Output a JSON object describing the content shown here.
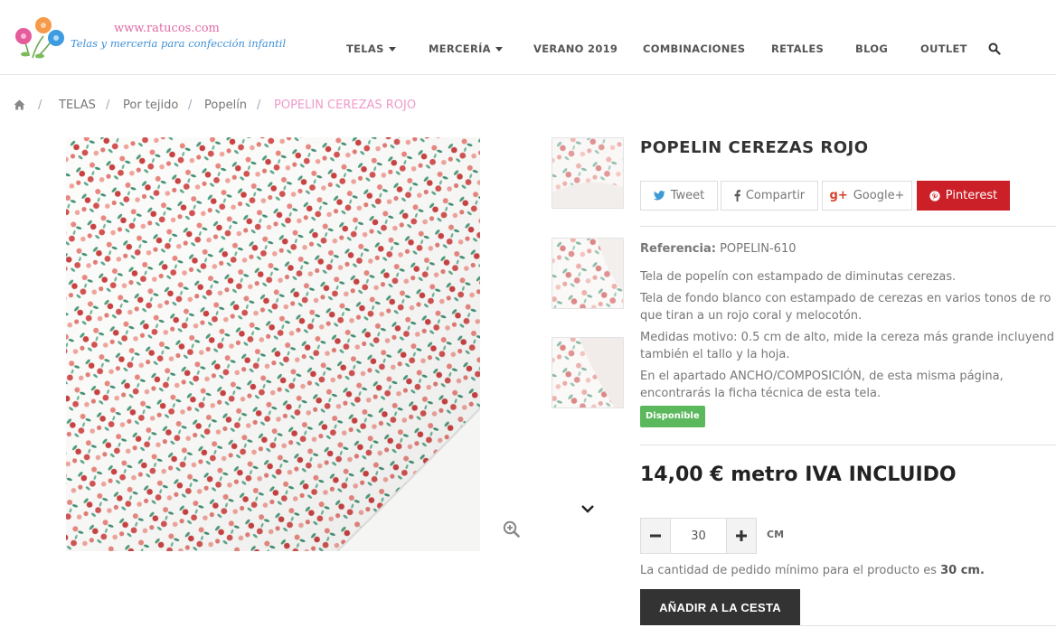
{
  "site": {
    "url_text": "www.ratucos.com",
    "tagline": "Telas y merceria para confección infantil"
  },
  "nav": [
    {
      "label": "TELAS",
      "has_caret": true
    },
    {
      "label": "MERCERÍA",
      "has_caret": true
    },
    {
      "label": "VERANO 2019",
      "has_caret": false
    },
    {
      "label": "COMBINACIONES",
      "has_caret": false
    },
    {
      "label": "RETALES",
      "has_caret": false
    },
    {
      "label": "BLOG",
      "has_caret": false
    },
    {
      "label": "OUTLET",
      "has_caret": false
    }
  ],
  "breadcrumb": {
    "separator": "/",
    "items": [
      "TELAS",
      "Por tejido",
      "Popelín"
    ],
    "current": "POPELIN CEREZAS ROJO"
  },
  "product": {
    "title": "POPELIN CEREZAS ROJO",
    "share": {
      "tweet": "Tweet",
      "facebook": "Compartir",
      "google": "Google+",
      "pinterest": "Pinterest"
    },
    "reference_label": "Referencia:",
    "reference_value": "POPELIN-610",
    "description": [
      "Tela de popelín con estampado de diminutas cerezas.",
      "Tela de fondo blanco con estampado de cerezas en varios tonos de ro",
      "que tiran a un rojo coral y melocotón.",
      "Medidas motivo: 0.5 cm de alto, mide la cereza más grande incluyend",
      "también el tallo y la hoja.",
      "En el apartado ANCHO/COMPOSICIÓN, de esta misma página,",
      "encontrarás la ficha técnica de esta tela."
    ],
    "availability": "Disponible",
    "price": "14,00 € metro IVA INCLUIDO",
    "quantity": "30",
    "unit": "CM",
    "min_note_prefix": "La cantidad de pedido mínimo para el producto es ",
    "min_note_value": "30 cm.",
    "add_to_cart": "AÑADIR A LA CESTA"
  },
  "icons": {
    "home": "home-icon",
    "search": "search-icon",
    "zoom": "zoom-in-icon",
    "next_thumb": "chevron-down-icon"
  },
  "colors": {
    "accent_pink": "#f09acb",
    "pinterest": "#cb2027",
    "available": "#5cb85c",
    "cart_button": "#333333"
  }
}
